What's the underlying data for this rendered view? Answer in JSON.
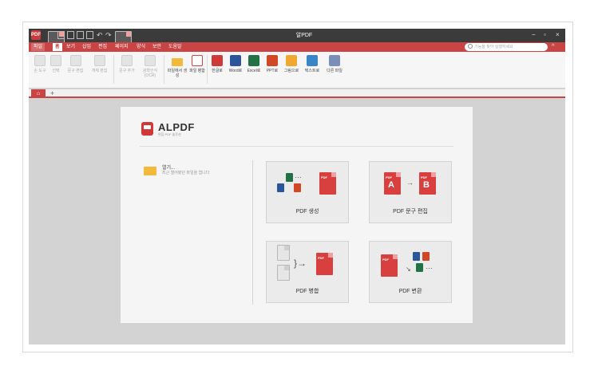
{
  "app": {
    "title": "알PDF",
    "logo_text": "PDF"
  },
  "window_controls": {
    "minimize": "−",
    "maximize": "▫",
    "close": "×"
  },
  "menu": {
    "items": [
      "파일",
      "홈",
      "보기",
      "삽입",
      "편집",
      "페이지",
      "양식",
      "보안",
      "도움말"
    ],
    "search_placeholder": "기능을 찾아 실행하세요",
    "collapse": "^"
  },
  "ribbon": {
    "groups": [
      [
        "손 도구",
        "선택",
        "문구 편집",
        "개체 편집"
      ],
      [
        "문구 추가",
        "광학인식(OCR)"
      ],
      [
        "파일에서 생성",
        "파일 병합"
      ],
      [
        "한글로",
        "Word로",
        "Excel로",
        "PPT로",
        "그림으로",
        "텍스트로",
        "다른 파일"
      ]
    ]
  },
  "tabs": {
    "home": "⌂",
    "add": "+"
  },
  "start": {
    "brand_name": "ALPDF",
    "brand_tag": "편집 PDF 솔루션",
    "open_title": "열기...",
    "open_sub": "최근 열어봤던 파일을 엽니다",
    "cards": [
      {
        "label": "PDF 생성"
      },
      {
        "label": "PDF 문구 편집"
      },
      {
        "label": "PDF 병합"
      },
      {
        "label": "PDF 변환"
      }
    ]
  }
}
